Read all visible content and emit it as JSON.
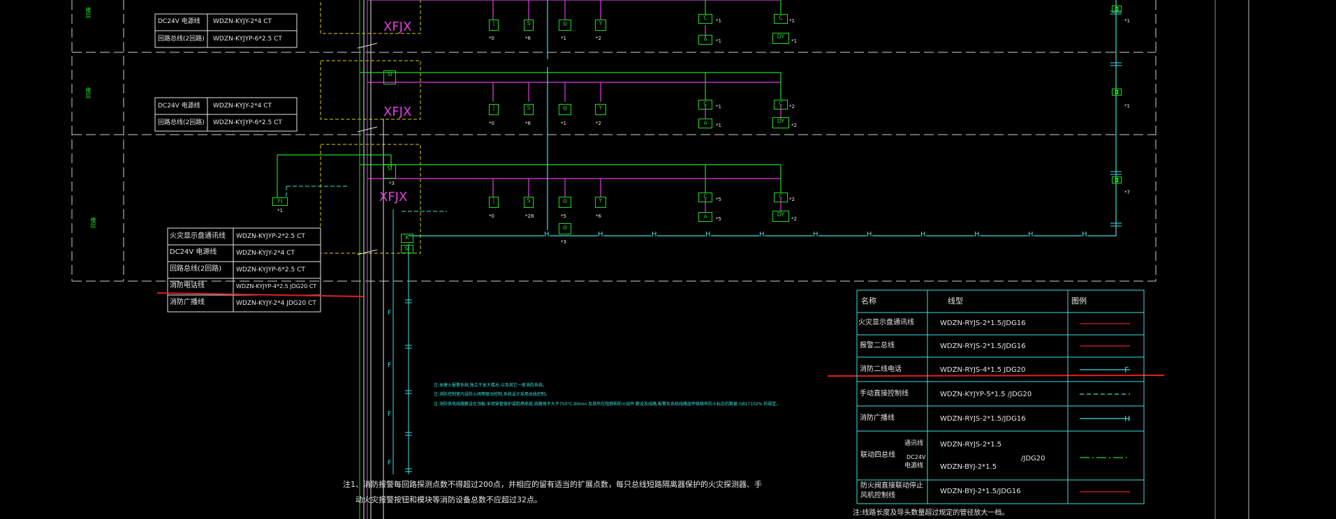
{
  "xfjx": {
    "label": "XFJX"
  },
  "floors": [
    {
      "name": "1",
      "tag": "楼层"
    },
    {
      "name": "2",
      "tag": "楼层"
    },
    {
      "name": "3",
      "tag": "楼层"
    }
  ],
  "floor_cable_tables": [
    {
      "rows": [
        {
          "name": "DC24V 电源线",
          "spec": "WDZN-KYJY-2*4  CT"
        },
        {
          "name": "回路总线(2回路)",
          "spec": "WDZN-KYJYP-6*2.5  CT"
        }
      ]
    },
    {
      "rows": [
        {
          "name": "DC24V 电源线",
          "spec": "WDZN-KYJY-2*4  CT"
        },
        {
          "name": "回路总线(2回路)",
          "spec": "WDZN-KYJYP-6*2.5  CT"
        }
      ]
    }
  ],
  "main_cable_table": {
    "rows": [
      {
        "name": "火灾显示盘通讯线",
        "spec": "WDZN-KYJYP-2*2.5  CT"
      },
      {
        "name": "DC24V    电源线",
        "spec": "WDZN-KYJY-2*4  CT"
      },
      {
        "name": "回路总线(2回路)",
        "spec": "WDZN-KYJYP-6*2.5  CT"
      },
      {
        "name": "消防电话线",
        "spec": "WDZN-KYJYP-4*2.5  JDG20  CT"
      },
      {
        "name": "消防广播线",
        "spec": "WDZN-KYJY-2*4  JDG20  CT"
      }
    ]
  },
  "legend": {
    "headers": [
      "名称",
      "线型",
      "图例"
    ],
    "rows": [
      {
        "name": "火灾显示盘通讯线",
        "spec": "WDZN-RYJS-2*1.5/JDG16",
        "color": "#e02020",
        "style": "solid",
        "mark": ""
      },
      {
        "name": "报警二总线",
        "spec": "WDZN-RYJS-2*1.5/JDG16",
        "color": "#e02020",
        "style": "solid",
        "mark": ""
      },
      {
        "name": "消防二线电话",
        "spec": "WDZN-RYJS-4*1.5  JDG20",
        "color": "#3de0e0",
        "style": "solid",
        "mark": "F"
      },
      {
        "name": "手动直接控制线",
        "spec": "WDZN-KYJYP-5*1.5  /JDG20",
        "color": "#3de0e0",
        "style": "dashed",
        "mark": ""
      },
      {
        "name": "消防广播线",
        "spec": "WDZN-RYJS-2*1.5/JDG16",
        "color": "#3de0e0",
        "style": "solid",
        "mark": "H"
      },
      {
        "name": "联动四总线",
        "sub1": "通讯线",
        "sub2a": "DC24V",
        "sub2b": "电源线",
        "spec": "WDZN-RYJS-2*1.5",
        "spec2": "WDZN-BYJ-2*1.5",
        "spec3": "/JDG20",
        "color": "#22d922",
        "style": "dashdot",
        "mark": ""
      },
      {
        "name": "防火阀直接联动停止风机控制线",
        "name1": "防火阀直接联动停止",
        "name2": "风机控制线",
        "spec": "WDZN-BYJ-2*1.5/JDG16",
        "color": "#e02020",
        "style": "solid",
        "mark": ""
      }
    ],
    "footnote": "注:线路长度及导头数量超过规定的管径放大一档。"
  },
  "notes": {
    "line1": "注1、消防报警每回路探测点数不得超过200点，并相应的留有适当的扩展点数，每只总线短路隔离器保护的火灾探测器、手",
    "line2": "动火灾报警按钮和模块等消防设备总数不应超过32点。",
    "small1": "注:本建火报警系统,独立于本大楼总,以及其它一般消防系统。",
    "small2": "注:消防控制室内设防火阀等联动控制,系统设计采用总线控制。",
    "small3": "注:消防供电线路敷设在顶板,采用穿管保护或阻燃电缆,线路每不大于750°C,90min 及其所在阻燃和防火组件 敷设及线路,报警及系统线路组件联络有防火标志的数据 GB17102%  的规定。"
  },
  "devices": {
    "module": "SI",
    "fi": "FI",
    "c": "C",
    "dy": "DY",
    "k": "K",
    "h": "H",
    "f": "F"
  },
  "device_labels": {
    "l0": "*0",
    "l1": "*1",
    "l2": "*2",
    "l3": "*3",
    "l5": "*5",
    "l6": "*6",
    "l28": "*28",
    "l7": "*7"
  }
}
